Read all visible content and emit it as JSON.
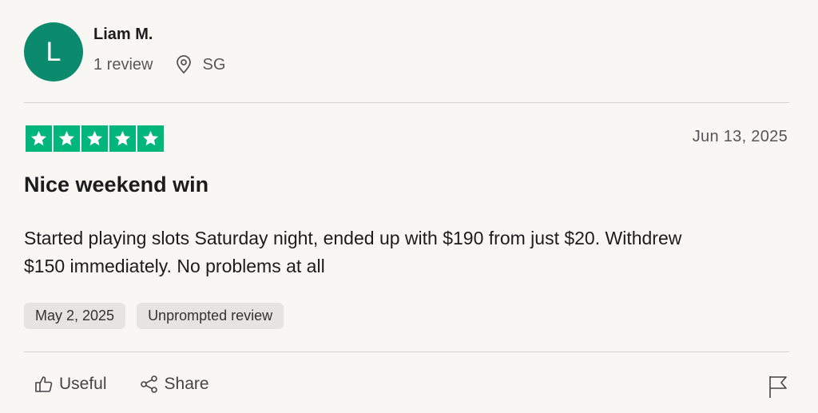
{
  "reviewer": {
    "initial": "L",
    "name": "Liam M.",
    "review_count": "1 review",
    "country": "SG",
    "avatar_color": "#0c8a6e"
  },
  "rating": {
    "stars": 5,
    "max_stars": 5,
    "star_color": "#00b67a"
  },
  "review": {
    "date": "Jun 13, 2025",
    "title": "Nice weekend win",
    "body": "Started playing slots Saturday night, ended up with $190 from just $20. Withdrew $150 immediately. No problems at all",
    "experience_date": "May 2, 2025",
    "tag": "Unprompted review"
  },
  "actions": {
    "useful_label": "Useful",
    "share_label": "Share"
  },
  "icons": {
    "location": "location-pin-icon",
    "useful": "thumbs-up-icon",
    "share": "share-icon",
    "report": "flag-icon",
    "star": "star-icon"
  }
}
